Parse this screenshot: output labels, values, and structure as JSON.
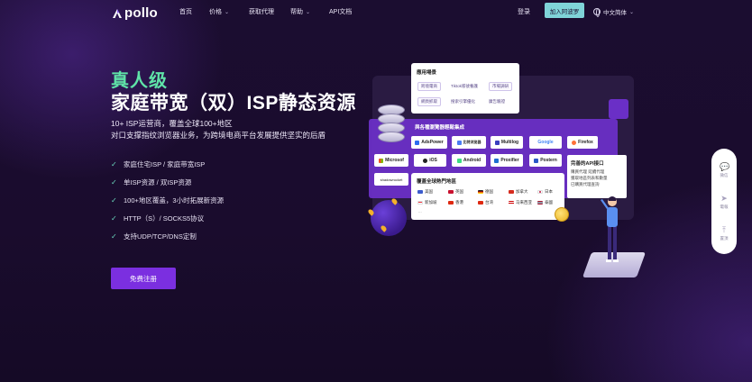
{
  "nav": {
    "logo_text": "pollo",
    "items": [
      {
        "label": "首页",
        "has_dropdown": false
      },
      {
        "label": "价格",
        "has_dropdown": true
      },
      {
        "label": "获取代理",
        "has_dropdown": false
      },
      {
        "label": "帮助",
        "has_dropdown": true
      },
      {
        "label": "API文档",
        "has_dropdown": false
      }
    ],
    "login": "登录",
    "join": "加入阿波罗",
    "language": "中文简体"
  },
  "hero": {
    "tag": "真人级",
    "title": "家庭带宽（双）ISP静态资源",
    "subtitle_line1": "10+ ISP运营商，覆盖全球100+地区",
    "subtitle_line2": "对口支撑指纹浏览器业务，为跨境电商平台发展提供坚实的后盾",
    "features": [
      "家庭住宅ISP / 家庭带宽ISP",
      "单ISP资源 / 双ISP资源",
      "100+地区覆盖，3小时拓展新资源",
      "HTTP（S）/ SOCKS5协议",
      "支持UDP/TCP/DNS定制"
    ],
    "cta": "免费注册"
  },
  "illustration": {
    "scenarios": {
      "title": "應用場景",
      "tags": [
        "跨境電商",
        "Tiktok賬號養護",
        "市場調研",
        "網頁抓取",
        "搜索引擎優化",
        "廣告驗證"
      ]
    },
    "browsers": {
      "title": "與各種瀏覽器輕鬆集成",
      "items": [
        "AdsPower",
        "比特浏览器",
        "Multilog",
        "Google",
        "Firefox",
        "Microsof",
        "iOS",
        "Android",
        "Proxifier",
        "Postern",
        "shadowrocket"
      ]
    },
    "regions": {
      "title": "覆蓋全球熱門地區",
      "items": [
        {
          "name": "美国",
          "color": "#3b5bcc"
        },
        {
          "name": "英国",
          "color": "#c8102e"
        },
        {
          "name": "德国",
          "color": "#222222"
        },
        {
          "name": "加拿大",
          "color": "#d52b1e"
        },
        {
          "name": "日本",
          "color": "#bc002d"
        },
        {
          "name": "新加坡",
          "color": "#ef3340"
        },
        {
          "name": "香港",
          "color": "#de2910"
        },
        {
          "name": "台湾",
          "color": "#de2910"
        },
        {
          "name": "马来西亚",
          "color": "#cc0001"
        },
        {
          "name": "泰國",
          "color": "#2d2a4a"
        }
      ],
      "more": "..."
    },
    "api": {
      "title": "完善的API接口",
      "lines": [
        "購買代理  延續代理",
        "獲取地區列表和數量",
        "已購買代理查詢"
      ]
    }
  },
  "float_bar": {
    "items": [
      {
        "label": "微信",
        "icon": "wechat-icon"
      },
      {
        "label": "電報",
        "icon": "telegram-icon"
      },
      {
        "label": "置頂",
        "icon": "back-to-top-icon"
      }
    ]
  },
  "colors": {
    "accent_green": "#5fe3a8",
    "cta_purple": "#7b2fe0",
    "join_teal": "#7fd3d8",
    "background": "#1a0c2e"
  }
}
